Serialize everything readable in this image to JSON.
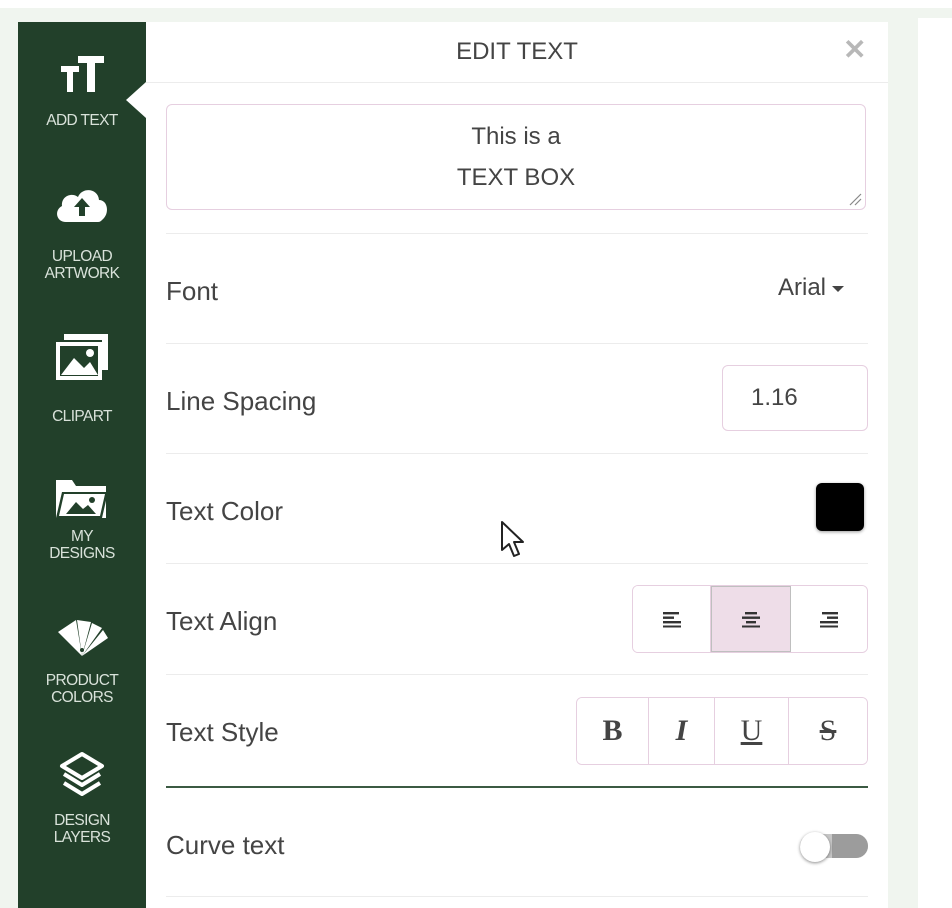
{
  "sidebar": {
    "items": [
      {
        "label": "ADD TEXT",
        "icon": "text-size-icon"
      },
      {
        "label": "UPLOAD\nARTWORK",
        "icon": "cloud-upload-icon"
      },
      {
        "label": "CLIPART",
        "icon": "image-stack-icon"
      },
      {
        "label": "MY\nDESIGNS",
        "icon": "folder-image-icon"
      },
      {
        "label": "PRODUCT\nCOLORS",
        "icon": "color-swatch-fan-icon"
      },
      {
        "label": "DESIGN\nLAYERS",
        "icon": "layers-icon"
      }
    ],
    "active": "ADD TEXT",
    "background": "#22402a"
  },
  "panel": {
    "title": "EDIT TEXT",
    "close_symbol": "✕",
    "text_value": "This is a\nTEXT BOX",
    "font": {
      "label": "Font",
      "value": "Arial"
    },
    "line_spacing": {
      "label": "Line Spacing",
      "value": "1.16"
    },
    "text_color": {
      "label": "Text Color",
      "value": "#000000"
    },
    "text_align": {
      "label": "Text Align",
      "options": [
        "left",
        "center",
        "right"
      ],
      "selected": "center"
    },
    "text_style": {
      "label": "Text Style",
      "buttons": [
        "B",
        "I",
        "U",
        "S"
      ]
    },
    "curve_text": {
      "label": "Curve text",
      "enabled": false
    }
  },
  "colors": {
    "accent_border": "#e6cfe0",
    "active_button": "#eedde8",
    "divider": "#3b5a43"
  }
}
